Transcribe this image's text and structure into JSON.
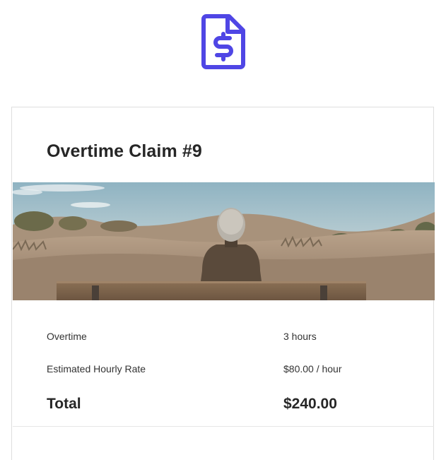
{
  "header": {
    "logo_icon": "invoice-dollar-icon",
    "logo_color": "#4f46e5"
  },
  "claim": {
    "title": "Overtime Claim #9",
    "image_alt": "Elderly person sitting on a wooden bench facing sand dunes",
    "details": [
      {
        "label": "Overtime",
        "value": "3 hours"
      },
      {
        "label": "Estimated Hourly Rate",
        "value": "$80.00 / hour"
      }
    ],
    "total": {
      "label": "Total",
      "value": "$240.00"
    }
  }
}
